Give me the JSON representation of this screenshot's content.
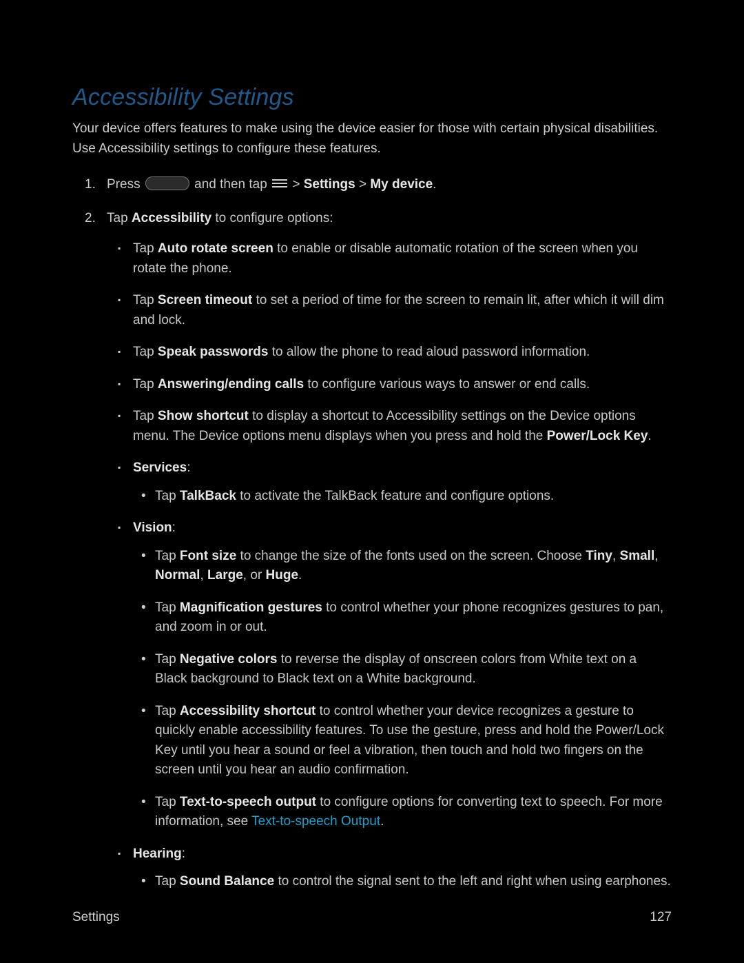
{
  "heading": "Accessibility Settings",
  "intro": "Your device offers features to make using the device easier for those with certain physical disabilities. Use Accessibility settings to configure these features.",
  "step1": {
    "press": "Press ",
    "and_tap": " and then tap ",
    "gt1": " > ",
    "settings": "Settings",
    "gt2": " > ",
    "mydevice": "My device",
    "period": "."
  },
  "step2": {
    "pre": "Tap ",
    "bold": "Accessibility",
    "post": " to configure options:"
  },
  "bullets": {
    "auto_rotate": {
      "pre": "Tap ",
      "b": "Auto rotate screen",
      "post": " to enable or disable automatic rotation of the screen when you rotate the phone."
    },
    "screen_timeout": {
      "pre": "Tap ",
      "b": "Screen timeout",
      "post": " to set a period of time for the screen to remain lit, after which it will dim and lock."
    },
    "speak_pw": {
      "pre": "Tap ",
      "b": "Speak passwords",
      "post": " to allow the phone to read aloud password information."
    },
    "answer_end": {
      "pre": "Tap ",
      "b": "Answering/ending calls",
      "post": " to configure various ways to answer or end calls."
    },
    "show_shortcut": {
      "pre": "Tap ",
      "b": "Show shortcut",
      "mid": " to display a shortcut to Accessibility settings on the Device options menu. The Device options menu displays when you press and hold the ",
      "b2": "Power/Lock Key",
      "post": "."
    }
  },
  "services_label": "Services",
  "services_colon": ":",
  "services": {
    "talkback": {
      "pre": "Tap ",
      "b": "TalkBack",
      "post": " to activate the TalkBack feature and configure options."
    }
  },
  "vision_label": "Vision",
  "vision_colon": ":",
  "vision": {
    "font_size": {
      "pre": "Tap ",
      "b": "Font size",
      "mid": " to change the size of the fonts used on the screen. Choose ",
      "b2": "Tiny",
      "c1": ", ",
      "b3": "Small",
      "c2": ", ",
      "b4": "Normal",
      "c3": ", ",
      "b5": "Large",
      "c4": ", or ",
      "b6": "Huge",
      "post": "."
    },
    "magnification": {
      "pre": "Tap ",
      "b": "Magnification gestures",
      "post": " to control whether your phone recognizes gestures to pan, and zoom in or out."
    },
    "negative": {
      "pre": "Tap ",
      "b": "Negative colors",
      "post": " to reverse the display of onscreen colors from White text on a Black background to Black text on a White background."
    },
    "shortcut": {
      "pre": "Tap ",
      "b": "Accessibility shortcut",
      "post": " to control whether your device recognizes a gesture to quickly enable accessibility features. To use the gesture, press and hold the Power/Lock Key until you hear a sound or feel a vibration, then touch and hold two fingers on the screen until you hear an audio confirmation."
    },
    "tts": {
      "pre": "Tap ",
      "b": "Text-to-speech output",
      "mid": " to configure options for converting text to speech. For more information, see ",
      "link": "Text-to-speech Output",
      "post": "."
    }
  },
  "hearing_label": "Hearing",
  "hearing_colon": ":",
  "hearing": {
    "sound_balance": {
      "pre": "Tap ",
      "b": "Sound Balance",
      "post": " to control the signal sent to the left and right when using earphones."
    }
  },
  "footer": {
    "section": "Settings",
    "page": "127"
  }
}
